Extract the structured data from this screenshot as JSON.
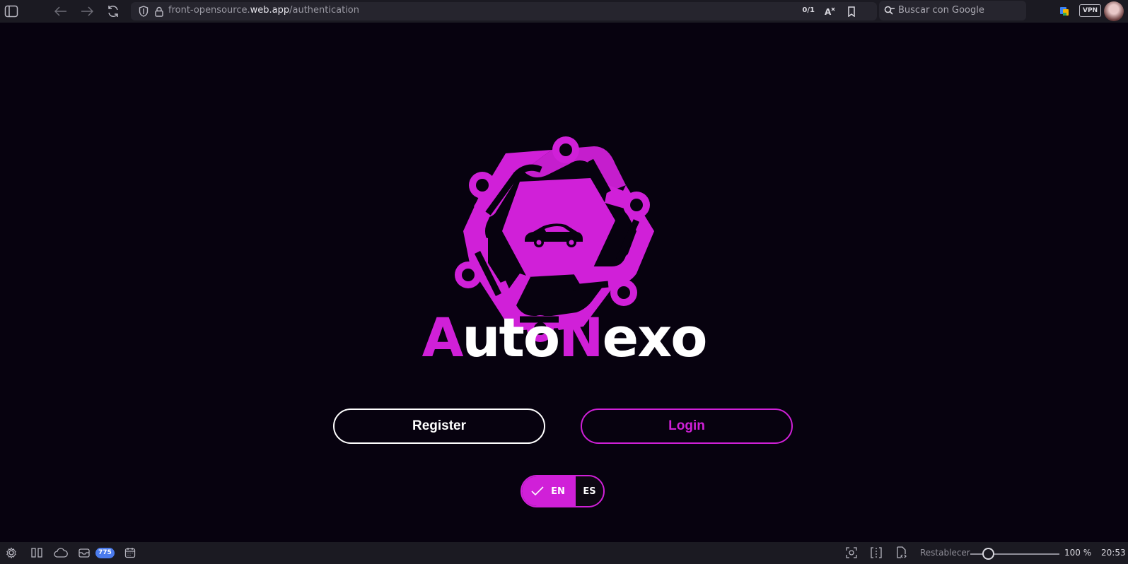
{
  "browser": {
    "url_prefix": "front-opensource.",
    "url_domain": "web.app",
    "url_path": "/authentication",
    "tab_counter": "0/1",
    "search_placeholder": "Buscar con Google",
    "vpn_label": "VPN"
  },
  "app": {
    "brand_first_accent": "A",
    "brand_first_rest": "uto",
    "brand_second_accent": "N",
    "brand_second_rest": "exo",
    "register_label": "Register",
    "login_label": "Login",
    "language": {
      "options": [
        "EN",
        "ES"
      ],
      "selected": "EN"
    }
  },
  "statusbar": {
    "mail_count": "775",
    "reset_label": "Restablecer",
    "zoom": "100 %",
    "zoom_level_fraction": 0.15,
    "time": "20:53"
  },
  "colors": {
    "accent": "#d020d8",
    "background": "#07020f",
    "chrome": "#1b1a22"
  },
  "icons": [
    "sidebar-toggle-icon",
    "back-arrow-icon",
    "forward-arrow-icon",
    "reload-icon",
    "shield-icon",
    "lock-icon",
    "translate-icon",
    "bookmark-icon",
    "search-icon",
    "extension-icon",
    "settings-icon",
    "tabs-icon",
    "cloud-icon",
    "mail-icon",
    "calendar-icon",
    "screenshot-icon",
    "split-view-icon",
    "page-capture-icon",
    "check-icon",
    "car-icon"
  ]
}
